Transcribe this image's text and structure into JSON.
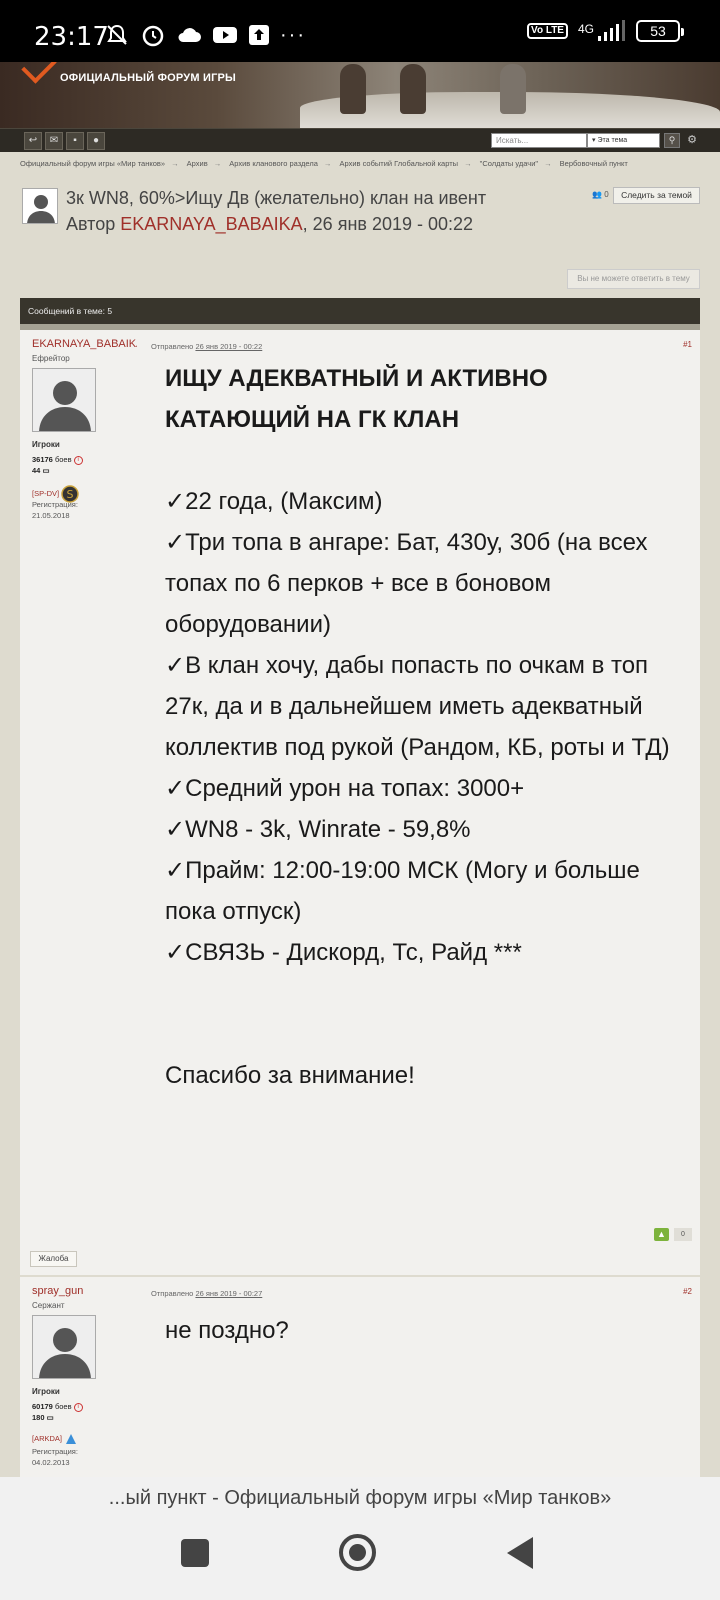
{
  "status_bar": {
    "time": "23:17",
    "network": "4G",
    "volte": "Vo LTE",
    "battery": "53"
  },
  "header": {
    "site_subtitle": "ОФИЦИАЛЬНЫЙ ФОРУМ ИГРЫ",
    "accent_color": "#e05a20"
  },
  "toolbar": {
    "search_placeholder": "Искать...",
    "scope_value": "Эта тема"
  },
  "breadcrumb": [
    "Официальный форум игры «Мир танков»",
    "Архив",
    "Архив кланового раздела",
    "Архив событий Глобальной карты",
    "\"Солдаты удачи\"",
    "Вербовочный пункт"
  ],
  "topic": {
    "title": "3к WN8, 60%>Ищу Дв (желательно) клан на ивент",
    "author_prefix": "Автор ",
    "author_name": "EKARNAYA_BABAIKA",
    "author_suffix": ", 26 янв 2019 - 00:22",
    "follower_count": "0",
    "follow_label": "Следить за темой",
    "no_reply_label": "Вы не можете ответить в тему"
  },
  "posts_bar": {
    "label": "Сообщений в теме: 5"
  },
  "posts": [
    {
      "name": "EKARNAYA_BABAIKA",
      "rank": "Ефрейтор",
      "group": "Игроки",
      "battles_num": "36176",
      "battles_label": " боев",
      "posts_count": "44",
      "clan": "[SP-DV]",
      "reg_label": "Регистрация:",
      "reg_date": "21.05.2018",
      "sent_label": "Отправлено ",
      "sent_date": "26 янв 2019 - 00:22",
      "number": "#1",
      "heading_line1": "ИЩУ АДЕКВАТНЫЙ И АКТИВНО",
      "heading_line2": "КАТАЮЩИЙ НА ГК КЛАН",
      "lines": [
        "✓22 года, (Максим)",
        "✓Три топа в ангаре: Бат, 430у, 30б (на всех топах по 6 перков + все в боновом оборудовании)",
        "✓В клан хочу, дабы попасть по очкам в топ 27к, да и в дальнейшем иметь адекватный коллектив под рукой (Рандом, КБ, роты и ТД)",
        "✓Средний урон на топах: 3000+",
        "✓WN8 - 3k, Winrate - 59,8%",
        "✓Прайм: 12:00-19:00 МСК (Могу и больше пока отпуск)",
        "✓СВЯЗЬ - Дискорд, Тс, Райд ***"
      ],
      "closing": "Спасибо за внимание!",
      "rep": "0",
      "report_label": "Жалоба"
    },
    {
      "name": "spray_gun",
      "rank": "Сержант",
      "group": "Игроки",
      "battles_num": "60179",
      "battles_label": " боев",
      "posts_count": "180",
      "clan": "[ARKDA]",
      "reg_label": "Регистрация:",
      "reg_date": "04.02.2013",
      "sent_label": "Отправлено ",
      "sent_date": "26 янв 2019 - 00:27",
      "number": "#2",
      "text": "не поздно?"
    }
  ],
  "url_bar": {
    "text": "...ый пункт - Официальный форум игры «Мир танков»"
  }
}
